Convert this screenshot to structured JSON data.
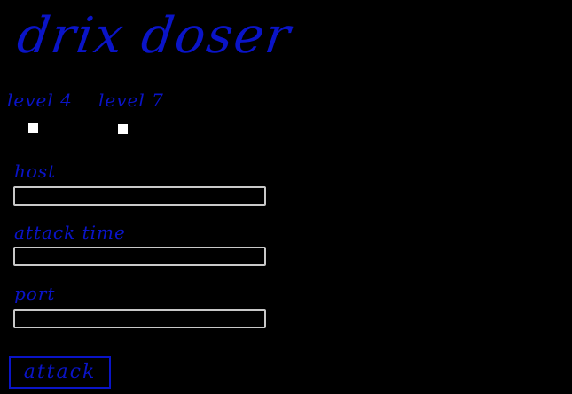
{
  "app": {
    "title": "drix doser"
  },
  "levels": [
    {
      "label": "level 4",
      "checked": false
    },
    {
      "label": "level 7",
      "checked": false
    }
  ],
  "fields": [
    {
      "label": "host",
      "value": "",
      "placeholder": ""
    },
    {
      "label": "attack time",
      "value": "",
      "placeholder": ""
    },
    {
      "label": "port",
      "value": "",
      "placeholder": ""
    }
  ],
  "actions": {
    "attack_label": "attack"
  },
  "colors": {
    "background": "#000000",
    "accent": "#0a14c8",
    "input_border": "#c8c8c8",
    "checkbox": "#ffffff"
  }
}
